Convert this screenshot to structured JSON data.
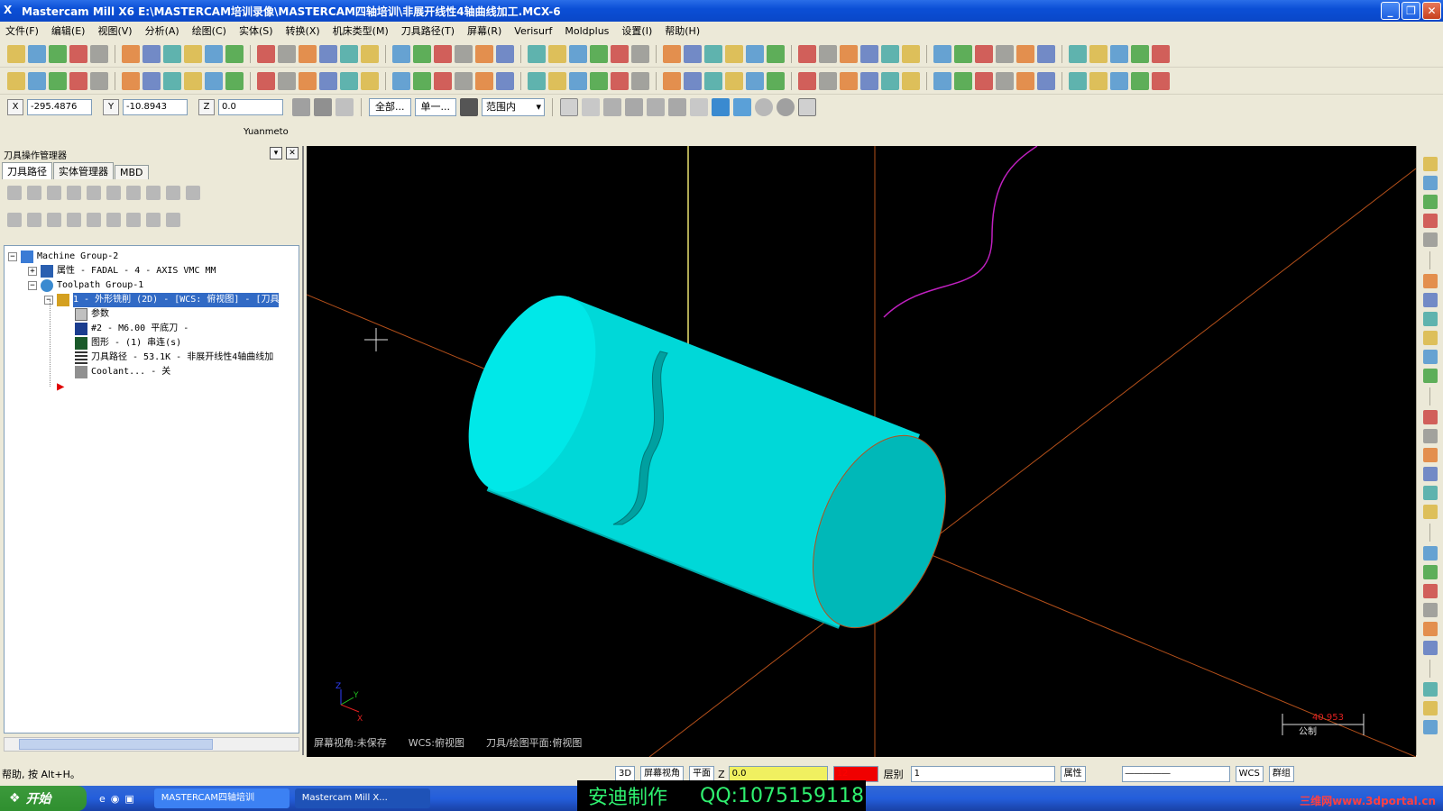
{
  "window": {
    "title": "Mastercam Mill X6  E:\\MASTERCAM培训录像\\MASTERCAM四轴培训\\非展开线性4轴曲线加工.MCX-6",
    "minimize_label": "_",
    "maximize_label": "❐",
    "close_label": "✕"
  },
  "menu": [
    "文件(F)",
    "编辑(E)",
    "视图(V)",
    "分析(A)",
    "绘图(C)",
    "实体(S)",
    "转换(X)",
    "机床类型(M)",
    "刀具路径(T)",
    "屏幕(R)",
    "Verisurf",
    "Moldplus",
    "设置(I)",
    "帮助(H)"
  ],
  "coords": {
    "x_label": "X",
    "x_value": "-295.4876",
    "y_label": "Y",
    "y_value": "-10.8943",
    "z_label": "Z",
    "z_value": "0.0",
    "btn_all": "全部...",
    "btn_single": "单一...",
    "range_select": "范围内"
  },
  "yuanmeto": "Yuanmeto",
  "panel": {
    "title": "刀具操作管理器",
    "tabs": [
      "刀具路径",
      "实体管理器",
      "MBD"
    ],
    "tree": [
      {
        "label": "Machine Group-2"
      },
      {
        "label": "属性 - FADAL - 4 - AXIS VMC MM"
      },
      {
        "label": "Toolpath Group-1"
      },
      {
        "label": "1 - 外形铣削 (2D) - [WCS: 俯视图] - [刀具"
      },
      {
        "label": "参数"
      },
      {
        "label": "#2 - M6.00 平底刀 -"
      },
      {
        "label": "图形 - (1) 串连(s)"
      },
      {
        "label": "刀具路径 - 53.1K - 非展开线性4轴曲线加"
      },
      {
        "label": "Coolant... - 关"
      }
    ]
  },
  "viewport": {
    "screen_view": "屏幕视角:未保存",
    "wcs": "WCS:俯视图",
    "plane": "刀具/绘图平面:俯视图",
    "scale_value": "40.953",
    "scale_unit": "公制",
    "axis_z": "Z",
    "axis_y": "Y",
    "axis_x": "X"
  },
  "statusbar": {
    "help": "帮助, 按 Alt+H。",
    "mode_3d": "3D",
    "screen_view": "屏幕视角",
    "plane": "平面",
    "z_label": "Z",
    "z_value": "0.0",
    "color_value": "12",
    "layer_label": "层别",
    "layer_value": "1",
    "attr": "属性",
    "wcs": "WCS",
    "group": "群组"
  },
  "taskbar": {
    "start": "开始",
    "items": [
      "MASTERCAM四轴培训",
      "Mastercam Mill X..."
    ]
  },
  "watermark": {
    "left": "安迪制作",
    "right": "QQ:1075159118",
    "site": "三维网www.3dportal.cn"
  },
  "colors": {
    "cylinder": "#00e0e0",
    "cylinder_shade": "#00b5b5",
    "axis_line": "#b5501a",
    "curve": "#c020c0",
    "tool_line": "#e8e070"
  }
}
